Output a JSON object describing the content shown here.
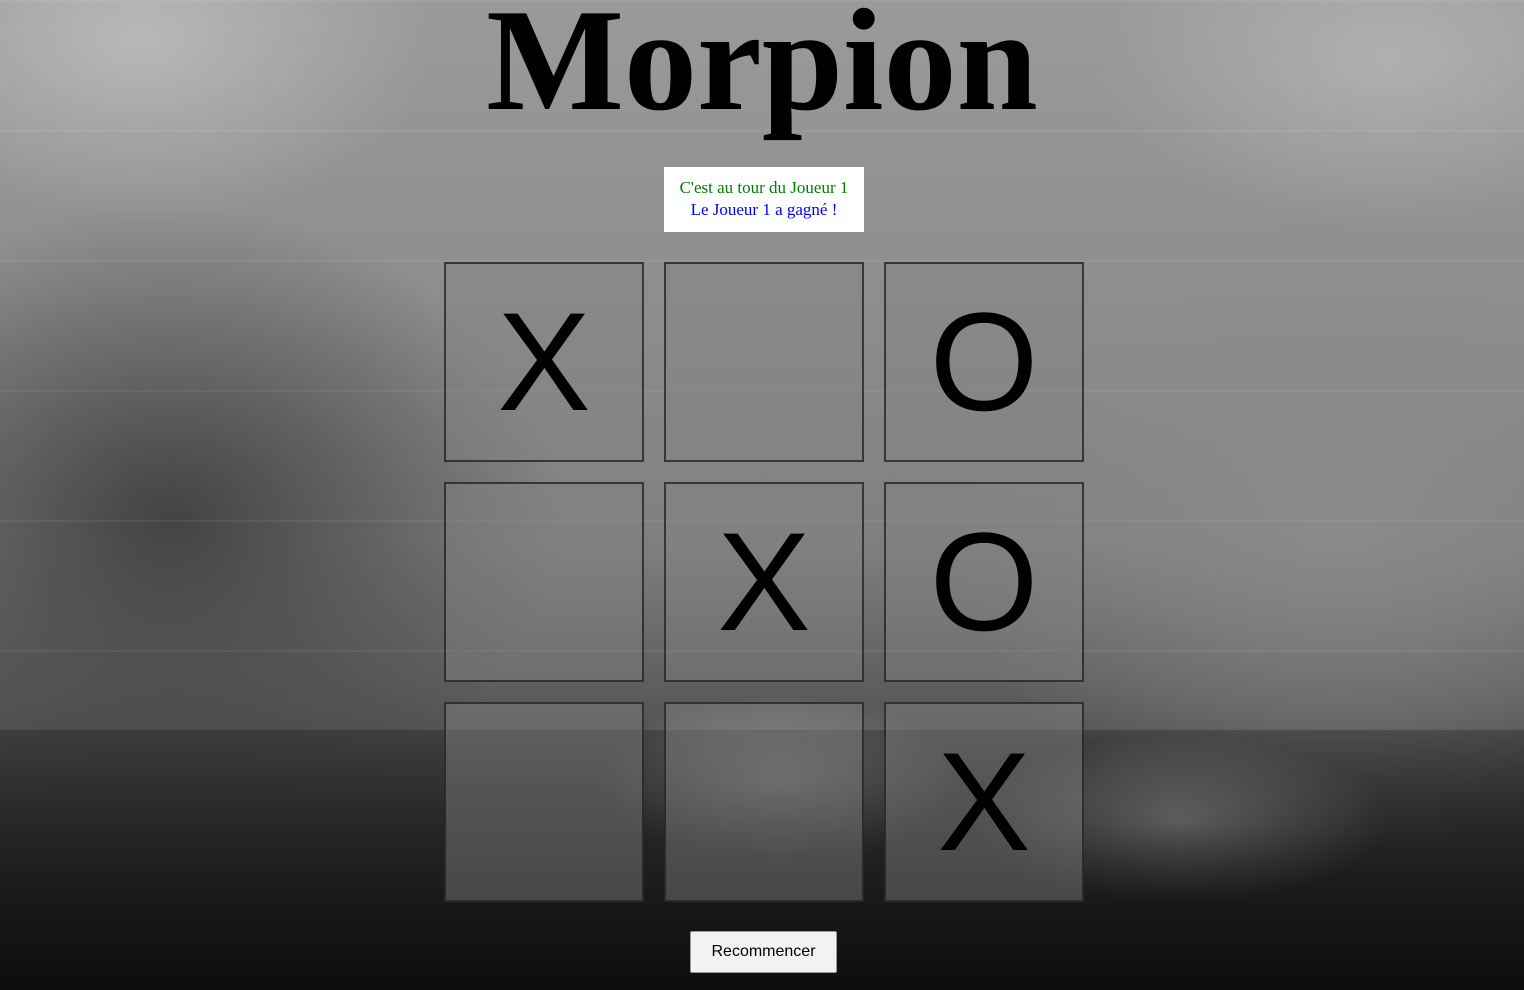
{
  "title": "Morpion",
  "status": {
    "turn_text": "C'est au tour du Joueur 1",
    "win_text": "Le Joueur 1 a gagné !",
    "turn_color": "#008000",
    "win_color": "#0000ff"
  },
  "board": {
    "cells": [
      "X",
      "",
      "O",
      "",
      "X",
      "O",
      "",
      "",
      "X"
    ]
  },
  "restart_label": "Recommencer"
}
